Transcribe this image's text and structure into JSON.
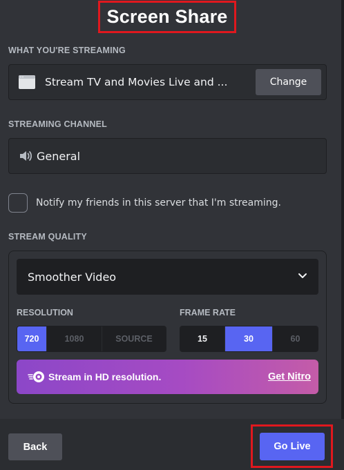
{
  "header": {
    "title": "Screen Share"
  },
  "streaming": {
    "label": "WHAT YOU'RE STREAMING",
    "app_title": "Stream TV and Movies Live and ...",
    "change_label": "Change"
  },
  "channel": {
    "label": "STREAMING CHANNEL",
    "name": "General"
  },
  "notify": {
    "text": "Notify my friends in this server that I'm streaming.",
    "checked": false
  },
  "quality": {
    "label": "STREAM QUALITY",
    "preset": "Smoother Video",
    "resolution_label": "RESOLUTION",
    "resolution_options": [
      "720",
      "1080",
      "SOURCE"
    ],
    "resolution_selected": "720",
    "framerate_label": "FRAME RATE",
    "framerate_options": [
      "15",
      "30",
      "60"
    ],
    "framerate_selected": "30"
  },
  "nitro": {
    "text": "Stream in HD resolution.",
    "link": "Get Nitro"
  },
  "footer": {
    "back_label": "Back",
    "go_live_label": "Go Live"
  },
  "colors": {
    "background": "#313338",
    "panel": "#2b2d31",
    "accent": "#5865f2",
    "highlight_box": "#e0181e"
  },
  "icons": [
    "app-window-icon",
    "speaker-icon",
    "chevron-down-icon",
    "nitro-icon"
  ]
}
